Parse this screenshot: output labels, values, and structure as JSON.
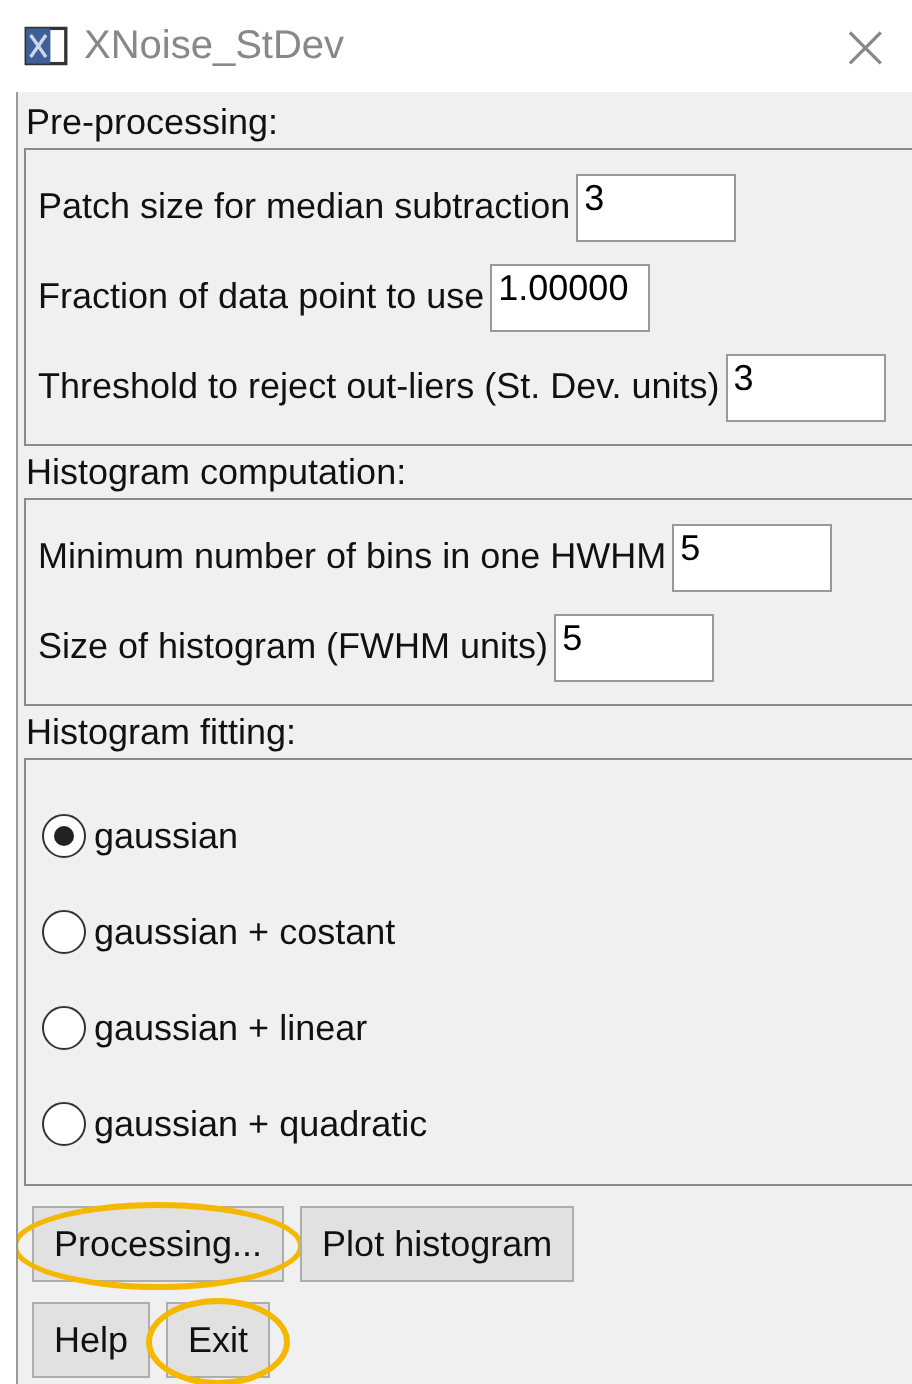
{
  "window": {
    "title": "XNoise_StDev",
    "close": "×"
  },
  "sections": [
    {
      "title": "Pre-processing:",
      "fields": [
        {
          "label": "Patch size for median subtraction",
          "value": "3"
        },
        {
          "label": "Fraction of data point to use",
          "value": "1.00000"
        },
        {
          "label": "Threshold to reject out-liers (St. Dev. units)",
          "value": "3"
        }
      ]
    },
    {
      "title": "Histogram computation:",
      "fields": [
        {
          "label": "Minimum number of bins in one HWHM",
          "value": "5"
        },
        {
          "label": "Size of histogram (FWHM units)",
          "value": "5"
        }
      ]
    },
    {
      "title": "Histogram fitting:",
      "options": [
        {
          "label": "gaussian",
          "selected": true
        },
        {
          "label": "gaussian + costant",
          "selected": false
        },
        {
          "label": "gaussian + linear",
          "selected": false
        },
        {
          "label": "gaussian + quadratic",
          "selected": false
        }
      ]
    }
  ],
  "button_rows": [
    [
      {
        "label": "Processing...",
        "highlighted": true
      },
      {
        "label": "Plot histogram",
        "highlighted": false
      }
    ],
    [
      {
        "label": "Help",
        "highlighted": false
      },
      {
        "label": "Exit",
        "highlighted": true
      }
    ]
  ]
}
